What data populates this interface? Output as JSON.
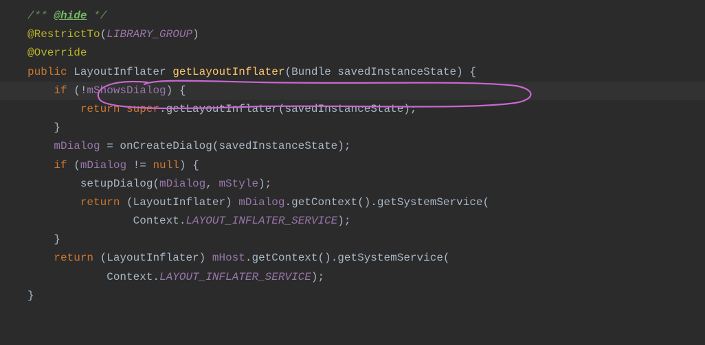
{
  "code": {
    "l1_comment_open": "/** ",
    "l1_doctag": "@hide",
    "l1_comment_close": " */",
    "l2_annotation": "@RestrictTo",
    "l2_paren_open": "(",
    "l2_const": "LIBRARY_GROUP",
    "l2_paren_close": ")",
    "l3_annotation": "@Override",
    "l4_kw_public": "public",
    "l4_type": " LayoutInflater ",
    "l4_method": "getLayoutInflater",
    "l4_params": "(Bundle savedInstanceState) {",
    "l5_kw_if": "    if ",
    "l5_cond": "(!",
    "l5_field": "mShowsDialog",
    "l5_cond_close": ") {",
    "l6_indent": "        ",
    "l6_kw_return": "return ",
    "l6_kw_super": "super",
    "l6_call": ".getLayoutInflater(savedInstanceState);",
    "l7": "    }",
    "l8": "",
    "l9_indent": "    ",
    "l9_field": "mDialog",
    "l9_rest": " = onCreateDialog(savedInstanceState);",
    "l10": "",
    "l11_kw_if": "    if ",
    "l11_open": "(",
    "l11_field": "mDialog",
    "l11_rest": " != ",
    "l11_null": "null",
    "l11_close": ") {",
    "l12_indent": "        setupDialog(",
    "l12_field1": "mDialog",
    "l12_comma": ", ",
    "l12_field2": "mStyle",
    "l12_close": ");",
    "l13": "",
    "l14_indent": "        ",
    "l14_kw_return": "return ",
    "l14_cast": "(LayoutInflater) ",
    "l14_field": "mDialog",
    "l14_rest": ".getContext().getSystemService(",
    "l15_indent": "                Context.",
    "l15_const": "LAYOUT_INFLATER_SERVICE",
    "l15_close": ");",
    "l16": "    }",
    "l17_indent": "    ",
    "l17_kw_return": "return ",
    "l17_cast": "(LayoutInflater) ",
    "l17_field": "mHost",
    "l17_rest": ".getContext().getSystemService(",
    "l18_indent": "            Context.",
    "l18_const": "LAYOUT_INFLATER_SERVICE",
    "l18_close": ");",
    "l19": "}"
  }
}
